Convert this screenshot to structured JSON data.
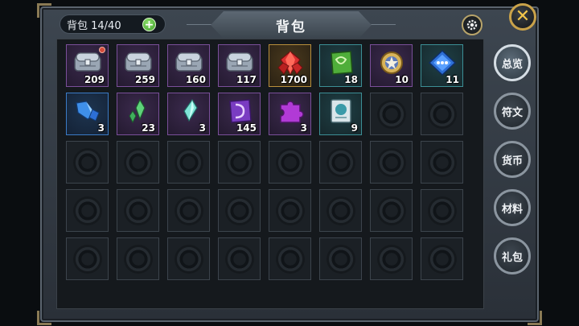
{
  "header": {
    "title": "背包",
    "capacity_label": "背包 14/40",
    "add_label": "+",
    "close_label": "✕"
  },
  "tabs": [
    {
      "label": "总览",
      "active": true
    },
    {
      "label": "符文",
      "active": false
    },
    {
      "label": "货币",
      "active": false
    },
    {
      "label": "材料",
      "active": false
    },
    {
      "label": "礼包",
      "active": false
    }
  ],
  "items": [
    {
      "icon": "silver-chest-icon",
      "count": "209",
      "rarity": "purple",
      "new": true
    },
    {
      "icon": "silver-chest-icon",
      "count": "259",
      "rarity": "purple",
      "new": false
    },
    {
      "icon": "silver-chest-icon",
      "count": "160",
      "rarity": "purple",
      "new": false
    },
    {
      "icon": "silver-chest-icon",
      "count": "117",
      "rarity": "purple",
      "new": false
    },
    {
      "icon": "red-gems-icon",
      "count": "1700",
      "rarity": "gold",
      "new": false
    },
    {
      "icon": "green-rune-stone-icon",
      "count": "18",
      "rarity": "teal",
      "new": false
    },
    {
      "icon": "gold-emblem-icon",
      "count": "10",
      "rarity": "purple",
      "new": false
    },
    {
      "icon": "blue-ticket-icon",
      "count": "11",
      "rarity": "teal",
      "new": false
    },
    {
      "icon": "blue-crystal-icon",
      "count": "3",
      "rarity": "blue",
      "new": false
    },
    {
      "icon": "green-shard-icon",
      "count": "23",
      "rarity": "purple",
      "new": false
    },
    {
      "icon": "teal-shard-icon",
      "count": "3",
      "rarity": "purple",
      "new": false
    },
    {
      "icon": "purple-rune-icon",
      "count": "145",
      "rarity": "purple",
      "new": false
    },
    {
      "icon": "purple-puzzle-icon",
      "count": "3",
      "rarity": "purple",
      "new": false
    },
    {
      "icon": "scroll-card-icon",
      "count": "9",
      "rarity": "teal",
      "new": false
    }
  ],
  "grid": {
    "columns": 8,
    "rows": 5
  },
  "colors": {
    "accent_gold": "#c9a24a",
    "add_green": "#3f9d2a"
  }
}
